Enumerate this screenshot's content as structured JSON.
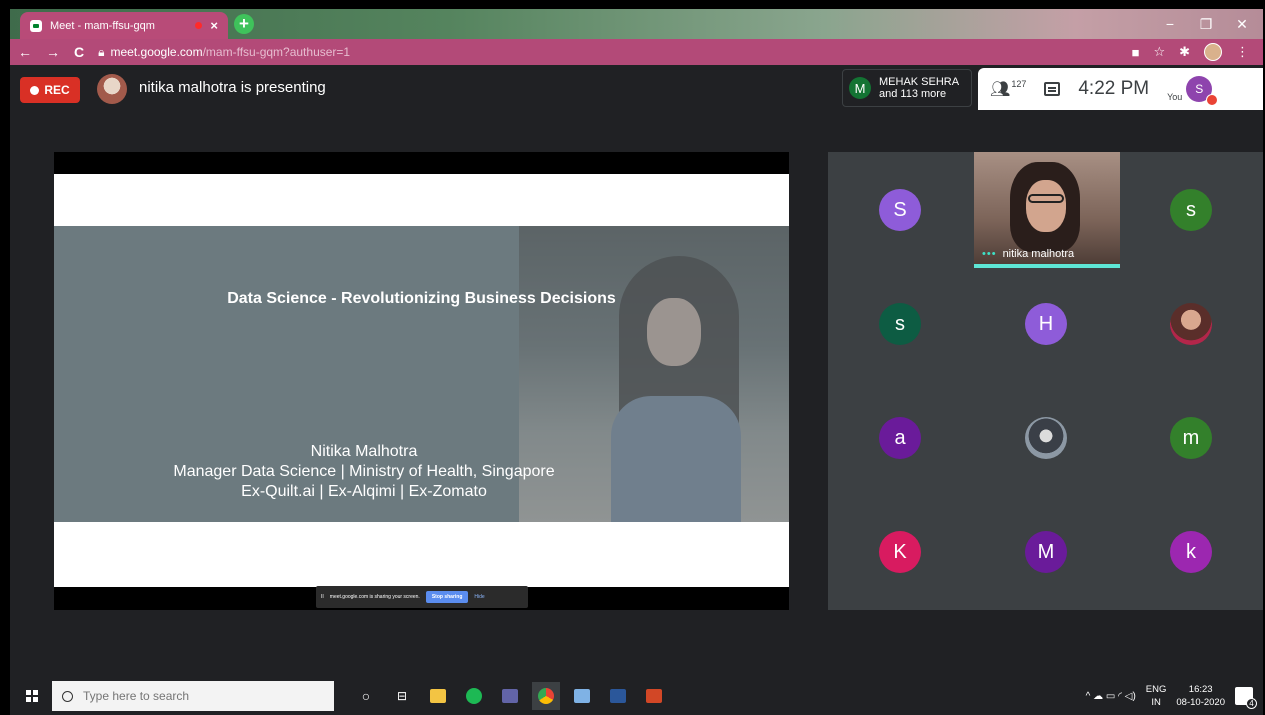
{
  "browser": {
    "tab_title": "Meet - mam-ffsu-gqm",
    "close_glyph": "×",
    "new_tab_glyph": "+",
    "url_host": "meet.google.com",
    "url_path": "/mam-ffsu-gqm?authuser=1",
    "window_controls": [
      "−",
      "❐",
      "✕"
    ],
    "nav": [
      "←",
      "→",
      "C"
    ],
    "toolbar_icons": [
      "camera-icon",
      "star-icon",
      "puzzle-icon",
      "profile-avatar"
    ]
  },
  "meet": {
    "rec_label": "REC",
    "presenting_text": "nitika malhotra is presenting",
    "people_chip": {
      "initial": "M",
      "line1": "MEHAK SEHRA",
      "line2": "and 113 more"
    },
    "participant_count": "127",
    "clock": "4:22 PM",
    "you_label": "You",
    "self_initial": "S"
  },
  "slide": {
    "title": "Data Science - Revolutionizing Business Decisions",
    "name": "Nitika Malhotra",
    "role": "Manager Data Science | Ministry of Health, Singapore",
    "history": "Ex-Quilt.ai | Ex-Alqimi | Ex-Zomato"
  },
  "share_bar": {
    "text": "meet.google.com is sharing your screen.",
    "stop_label": "Stop sharing",
    "hide_label": "Hide"
  },
  "grid": {
    "speaker_name": "nitika malhotra",
    "speaker_dots": "•••",
    "tiles": [
      {
        "initial": "S",
        "color": "#8e5cd9"
      },
      {
        "initial": "s",
        "color": "#33802b"
      },
      {
        "initial": "s",
        "color": "#0d5c43"
      },
      {
        "initial": "H",
        "color": "#8e5cd9"
      },
      {
        "initial": "a",
        "color": "#6a1b9a"
      },
      {
        "initial": "m",
        "color": "#33802b"
      },
      {
        "initial": "K",
        "color": "#d81b60"
      },
      {
        "initial": "M",
        "color": "#6a1b9a"
      },
      {
        "initial": "k",
        "color": "#9c27b0"
      }
    ]
  },
  "taskbar": {
    "search_placeholder": "Type here to search",
    "lang_line1": "ENG",
    "lang_line2": "IN",
    "time": "16:23",
    "date": "08-10-2020",
    "notif_count": "4",
    "tray_glyphs": "^ ☁ ▭ ◜ ◁)"
  },
  "colors": {
    "meet_bg": "#202124",
    "rec": "#d93025",
    "accent_teal": "#5ee6d5",
    "chrome_tab": "#b84b78"
  }
}
